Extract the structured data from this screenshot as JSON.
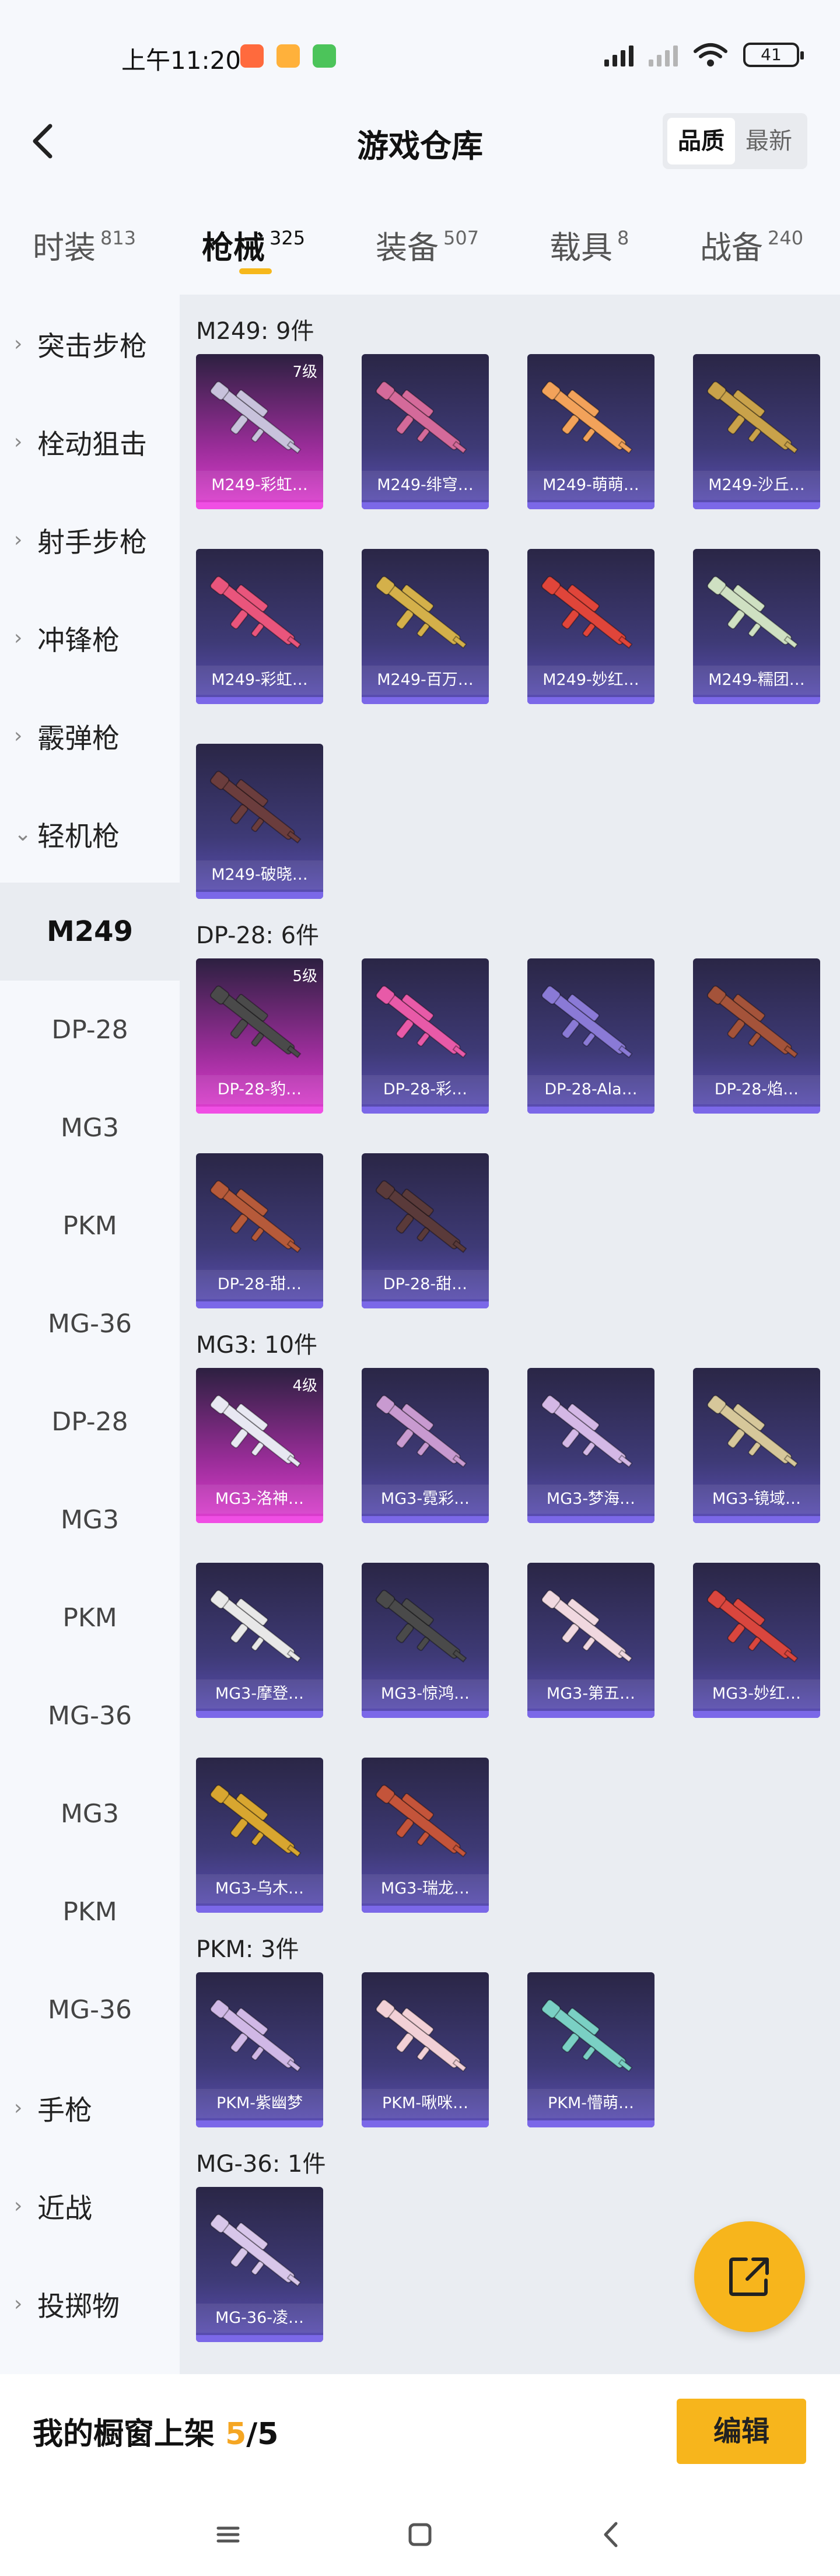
{
  "status": {
    "time": "上午11:20",
    "battery": "41",
    "app_icon_colors": [
      "#ff6a3d",
      "#ffb13b",
      "#4cc45a"
    ]
  },
  "header": {
    "title": "游戏仓库",
    "sort": {
      "options": [
        "品质",
        "最新"
      ],
      "active": 0
    }
  },
  "tabs": [
    {
      "label": "时装",
      "count": "813"
    },
    {
      "label": "枪械",
      "count": "325"
    },
    {
      "label": "装备",
      "count": "507"
    },
    {
      "label": "载具",
      "count": "8"
    },
    {
      "label": "战备",
      "count": "240"
    }
  ],
  "sidebar": {
    "cats_top": [
      "突击步枪",
      "栓动狙击",
      "射手步枪",
      "冲锋枪",
      "霰弹枪"
    ],
    "open_cat": "轻机枪",
    "subs": [
      "M249",
      "DP-28",
      "MG3",
      "PKM",
      "MG-36",
      "DP-28",
      "MG3",
      "PKM",
      "MG-36",
      "MG3",
      "PKM",
      "MG-36"
    ],
    "cats_bottom": [
      "手枪",
      "近战",
      "投掷物"
    ]
  },
  "sections": [
    {
      "title": "M249: 9件",
      "items": [
        {
          "name": "M249-彩虹…",
          "level": "7级",
          "gold": true,
          "color": "#c8c2dc"
        },
        {
          "name": "M249-绯穹…",
          "color": "#d46a9a"
        },
        {
          "name": "M249-萌萌…",
          "color": "#f2a25a"
        },
        {
          "name": "M249-沙丘…",
          "color": "#c9a24a"
        },
        {
          "name": "M249-彩虹…",
          "color": "#e9557c"
        },
        {
          "name": "M249-百万…",
          "color": "#d4b04a"
        },
        {
          "name": "M249-妙红…",
          "color": "#e0453a"
        },
        {
          "name": "M249-糯团…",
          "color": "#cfe0c2"
        },
        {
          "name": "M249-破晓…",
          "color": "#6b3d3d"
        }
      ]
    },
    {
      "title": "DP-28: 6件",
      "items": [
        {
          "name": "DP-28-豹…",
          "level": "5级",
          "gold": true,
          "color": "#4a4a4a"
        },
        {
          "name": "DP-28-彩…",
          "color": "#e85aa8"
        },
        {
          "name": "DP-28-Ala…",
          "color": "#8a7ad6"
        },
        {
          "name": "DP-28-焰…",
          "color": "#a4533a"
        },
        {
          "name": "DP-28-甜…",
          "color": "#b65a3a"
        },
        {
          "name": "DP-28-甜…",
          "color": "#5a3a3a"
        }
      ]
    },
    {
      "title": "MG3: 10件",
      "items": [
        {
          "name": "MG3-洛神…",
          "level": "4级",
          "gold": true,
          "color": "#e8e8f2"
        },
        {
          "name": "MG3-霓彩…",
          "color": "#c89ad0"
        },
        {
          "name": "MG3-梦海…",
          "color": "#d4b8e6"
        },
        {
          "name": "MG3-镜域…",
          "color": "#d6c79a"
        },
        {
          "name": "MG3-摩登…",
          "color": "#e8e8e8"
        },
        {
          "name": "MG3-惊鸿…",
          "color": "#4a4a4a"
        },
        {
          "name": "MG3-第五…",
          "color": "#f0d8e0"
        },
        {
          "name": "MG3-妙红…",
          "color": "#d9463e"
        },
        {
          "name": "MG3-乌木…",
          "color": "#d8a630"
        },
        {
          "name": "MG3-瑞龙…",
          "color": "#c4543a"
        }
      ]
    },
    {
      "title": "PKM: 3件",
      "items": [
        {
          "name": "PKM-紫幽梦",
          "color": "#d0b8e6"
        },
        {
          "name": "PKM-啾咪…",
          "color": "#f2d0d6"
        },
        {
          "name": "PKM-懵萌…",
          "color": "#7ad0c4"
        }
      ]
    },
    {
      "title": "MG-36: 1件",
      "items": [
        {
          "name": "MG-36-凌…",
          "color": "#d8c6ea"
        }
      ]
    }
  ],
  "bottom": {
    "label": "我的橱窗上架 ",
    "used": "5",
    "total": "/5",
    "edit": "编辑"
  }
}
